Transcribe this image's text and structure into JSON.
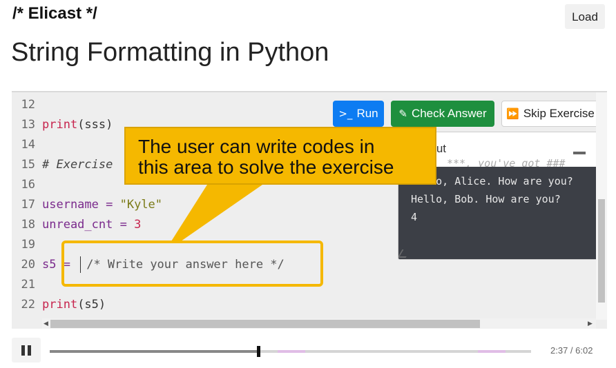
{
  "header": {
    "brand": "/* Elicast */",
    "load_label": "Load"
  },
  "page_title": "String Formatting in Python",
  "toolbar": {
    "run_label": "Run",
    "check_label": "Check Answer",
    "skip_label": "Skip Exercise"
  },
  "editor": {
    "line_numbers": [
      "12",
      "13",
      "14",
      "15",
      "16",
      "17",
      "18",
      "19",
      "20",
      "21",
      "22"
    ],
    "lines": {
      "l13_fn": "print",
      "l13_arg": "(sss)",
      "l15_comment": "# Exercise",
      "l17_var": "username",
      "l17_op": " = ",
      "l17_str": "\"Kyle\"",
      "l18_var": "unread_cnt",
      "l18_op": " = ",
      "l18_num": "3",
      "l20_var": "s5",
      "l20_op": " = ",
      "l22_fn": "print",
      "l22_arg": "(s5)"
    },
    "answer_placeholder": "/* Write your answer here */"
  },
  "output": {
    "title": "Output",
    "hint": "***, you've got ###",
    "lines": [
      "Hello, Alice. How are you?",
      "Hello, Bob. How are you?",
      "4"
    ]
  },
  "callout": {
    "text_line1": "The user can write codes in",
    "text_line2": "this area to solve the exercise"
  },
  "player": {
    "time": "2:37 / 6:02",
    "progress_fraction": 0.434
  },
  "colors": {
    "run": "#0d7cf2",
    "check": "#1e8f3e",
    "callout": "#f5b800",
    "output_bg": "#3c3f46"
  }
}
